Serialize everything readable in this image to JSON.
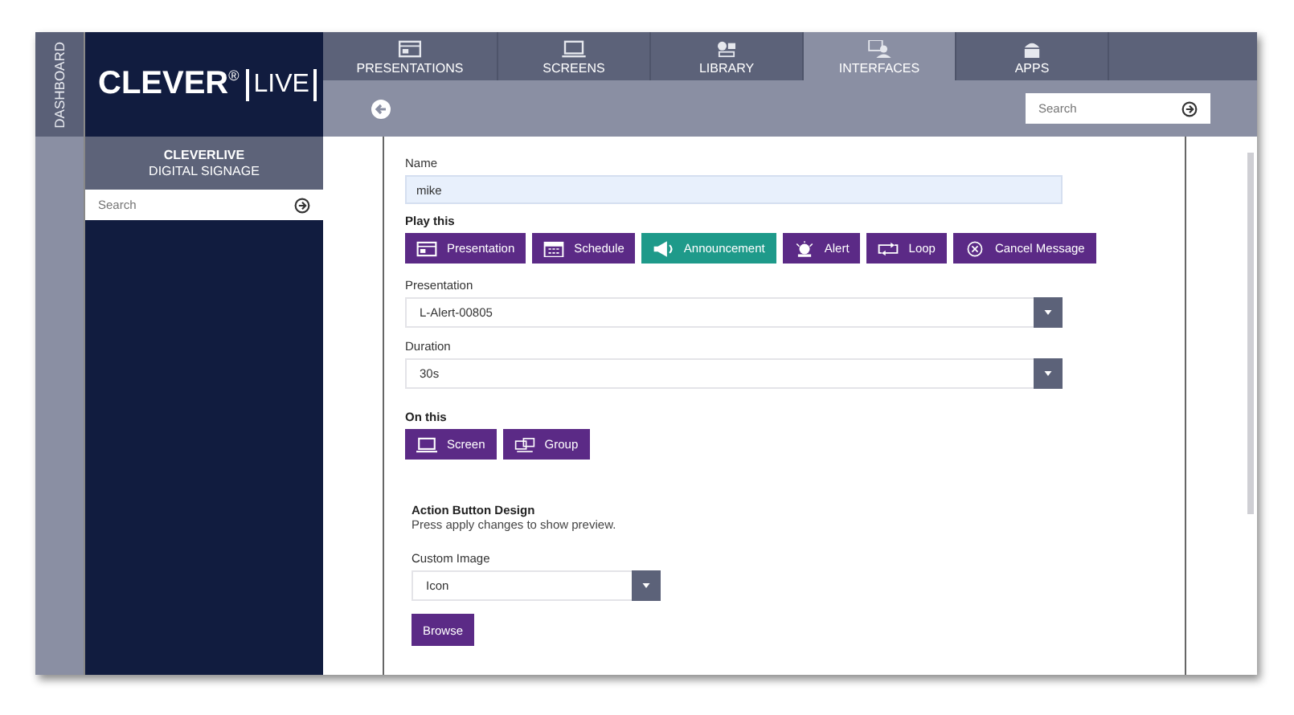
{
  "sidebar": {
    "vertical_tab": "DASHBOARD",
    "logo": {
      "word": "CLEVER",
      "mark": "®",
      "boxed": "LIVE"
    },
    "account": {
      "name": "CLEVERLIVE",
      "subtitle": "DIGITAL SIGNAGE"
    },
    "search": {
      "placeholder": "Search"
    }
  },
  "nav": {
    "tabs": [
      {
        "label": "PRESENTATIONS",
        "kind": "presentation",
        "selected": false
      },
      {
        "label": "SCREENS",
        "kind": "screen",
        "selected": false
      },
      {
        "label": "LIBRARY",
        "kind": "library",
        "selected": false
      },
      {
        "label": "INTERFACES",
        "kind": "interface",
        "selected": true
      },
      {
        "label": "APPS",
        "kind": "app",
        "selected": false
      }
    ]
  },
  "toolbar": {
    "search": {
      "placeholder": "Search"
    }
  },
  "form": {
    "name": {
      "label": "Name",
      "value": "mike"
    },
    "play_this": {
      "label": "Play this",
      "options": [
        {
          "label": "Presentation",
          "kind": "presentation",
          "selected": false
        },
        {
          "label": "Schedule",
          "kind": "schedule",
          "selected": false
        },
        {
          "label": "Announcement",
          "kind": "announcement",
          "selected": true
        },
        {
          "label": "Alert",
          "kind": "alert",
          "selected": false
        },
        {
          "label": "Loop",
          "kind": "loop",
          "selected": false
        },
        {
          "label": "Cancel Message",
          "kind": "cancel",
          "selected": false
        }
      ]
    },
    "presentation": {
      "label": "Presentation",
      "value": "L-Alert-00805"
    },
    "duration": {
      "label": "Duration",
      "value": "30s"
    },
    "on_this": {
      "label": "On this",
      "options": [
        {
          "label": "Screen",
          "kind": "screen",
          "selected": false
        },
        {
          "label": "Group",
          "kind": "group",
          "selected": false
        }
      ]
    },
    "design": {
      "title": "Action Button Design",
      "hint": "Press apply changes to show preview.",
      "custom_image": {
        "label": "Custom Image",
        "value": "Icon"
      },
      "browse": "Browse"
    }
  }
}
